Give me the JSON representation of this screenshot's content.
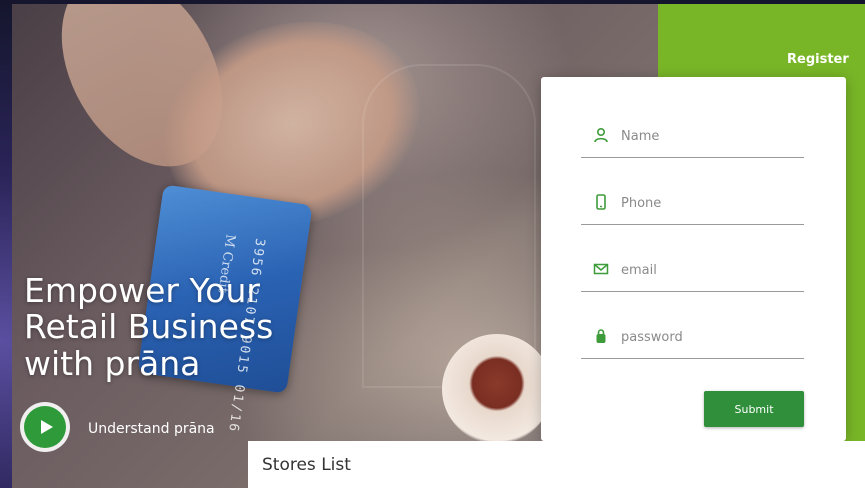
{
  "hero": {
    "headline_line1": "Empower Your",
    "headline_line2": "Retail Business",
    "headline_line3": "with prāna",
    "cta_label": "Understand prāna",
    "card_brand_text": "M Credit",
    "card_number_text": "3956 2107 9015 01/16"
  },
  "register": {
    "tab_label": "Register",
    "fields": [
      {
        "placeholder": "Name",
        "icon": "user-icon"
      },
      {
        "placeholder": "Phone",
        "icon": "phone-icon"
      },
      {
        "placeholder": "email",
        "icon": "mail-icon"
      },
      {
        "placeholder": "password",
        "icon": "lock-icon"
      }
    ],
    "submit_label": "Submit"
  },
  "stores": {
    "title": "Stores List"
  },
  "colors": {
    "accent_green": "#79b627",
    "button_green": "#2f8f3a",
    "icon_green": "#3e9b3a"
  }
}
